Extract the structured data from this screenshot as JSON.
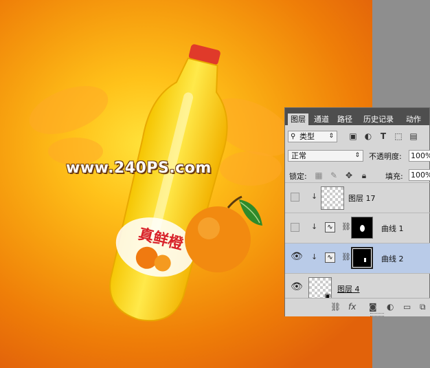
{
  "watermark": "www.240PS.com",
  "panel": {
    "tabs": [
      {
        "label": "图层",
        "active": true
      },
      {
        "label": "通道",
        "active": false
      },
      {
        "label": "路径",
        "active": false
      },
      {
        "label": "历史记录",
        "active": false
      },
      {
        "label": "动作",
        "active": false
      }
    ],
    "filter": {
      "kind_label": "类型"
    },
    "blend_mode": "正常",
    "opacity_label": "不透明度:",
    "opacity_value": "100%",
    "lock_label": "锁定:",
    "fill_label": "填充:",
    "fill_value": "100%",
    "layers": [
      {
        "name": "图层 17",
        "visible": false,
        "type": "pixel",
        "clipped": true,
        "selected": false
      },
      {
        "name": "曲线 1",
        "visible": false,
        "type": "curves",
        "clipped": true,
        "selected": false
      },
      {
        "name": "曲线 2",
        "visible": true,
        "type": "curves",
        "clipped": true,
        "selected": true
      },
      {
        "name": "图层 4",
        "visible": true,
        "type": "smart-object",
        "clipped": false,
        "selected": false
      }
    ]
  },
  "colors": {
    "accent_selected": "#b9cbe8",
    "panel_bg": "#d6d6d6",
    "tab_bar": "#4e4e4e"
  }
}
